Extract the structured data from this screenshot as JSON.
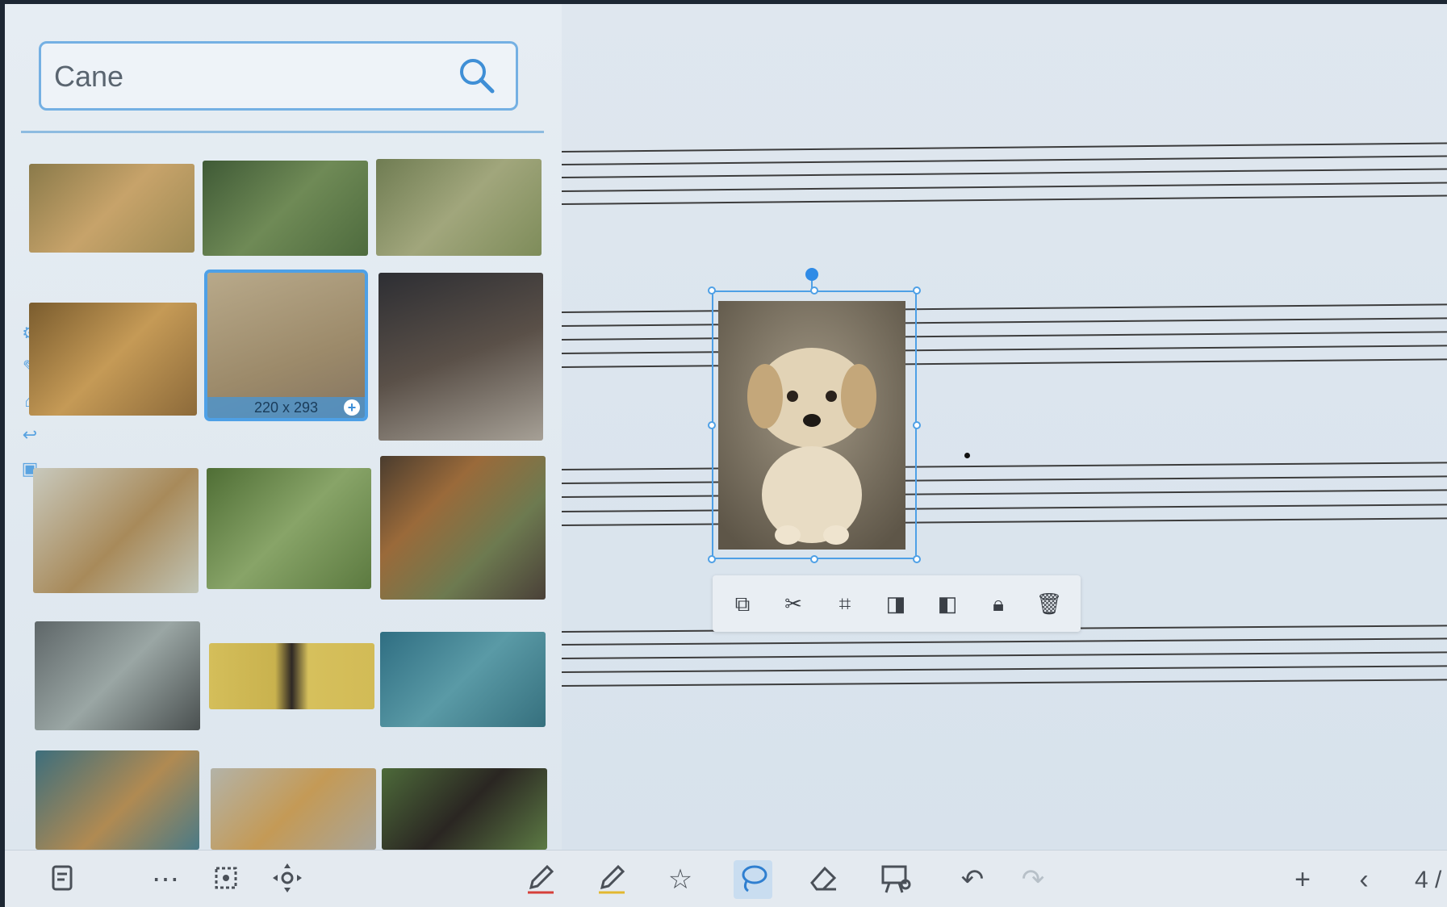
{
  "search": {
    "value": "Cane",
    "placeholder": ""
  },
  "images": [
    {
      "id": "dog-1",
      "tone": "#a8845a"
    },
    {
      "id": "dog-2",
      "tone": "#5c7248"
    },
    {
      "id": "dog-3",
      "tone": "#7b8a5a"
    },
    {
      "id": "dog-4",
      "tone": "#9c7a3e"
    },
    {
      "id": "dog-5",
      "tone": "#a8987a",
      "selected": true,
      "size_label": "220 x 293"
    },
    {
      "id": "dog-6",
      "tone": "#4a4238"
    },
    {
      "id": "dog-7",
      "tone": "#b9b8a8"
    },
    {
      "id": "dog-8",
      "tone": "#6d8a4e"
    },
    {
      "id": "dog-9",
      "tone": "#6a5a48"
    },
    {
      "id": "dog-10",
      "tone": "#6f7a78"
    },
    {
      "id": "dog-11",
      "tone": "#d2bb56"
    },
    {
      "id": "dog-12",
      "tone": "#3f7c8c"
    },
    {
      "id": "dog-13",
      "tone": "#4e7c8a"
    },
    {
      "id": "dog-14",
      "tone": "#a8a394"
    },
    {
      "id": "dog-15",
      "tone": "#4d6a3a"
    }
  ],
  "context_toolbar": {
    "buttons": [
      "copy",
      "cut",
      "crop",
      "bring-forward",
      "send-backward",
      "lock",
      "delete"
    ]
  },
  "bottom_toolbar": {
    "tools": [
      "notes",
      "more",
      "select-area",
      "move",
      "pen",
      "highlighter",
      "shapes",
      "lasso",
      "eraser",
      "present",
      "undo",
      "redo",
      "add-page",
      "prev-page"
    ],
    "active": "lasso",
    "page_indicator": "4 /"
  }
}
